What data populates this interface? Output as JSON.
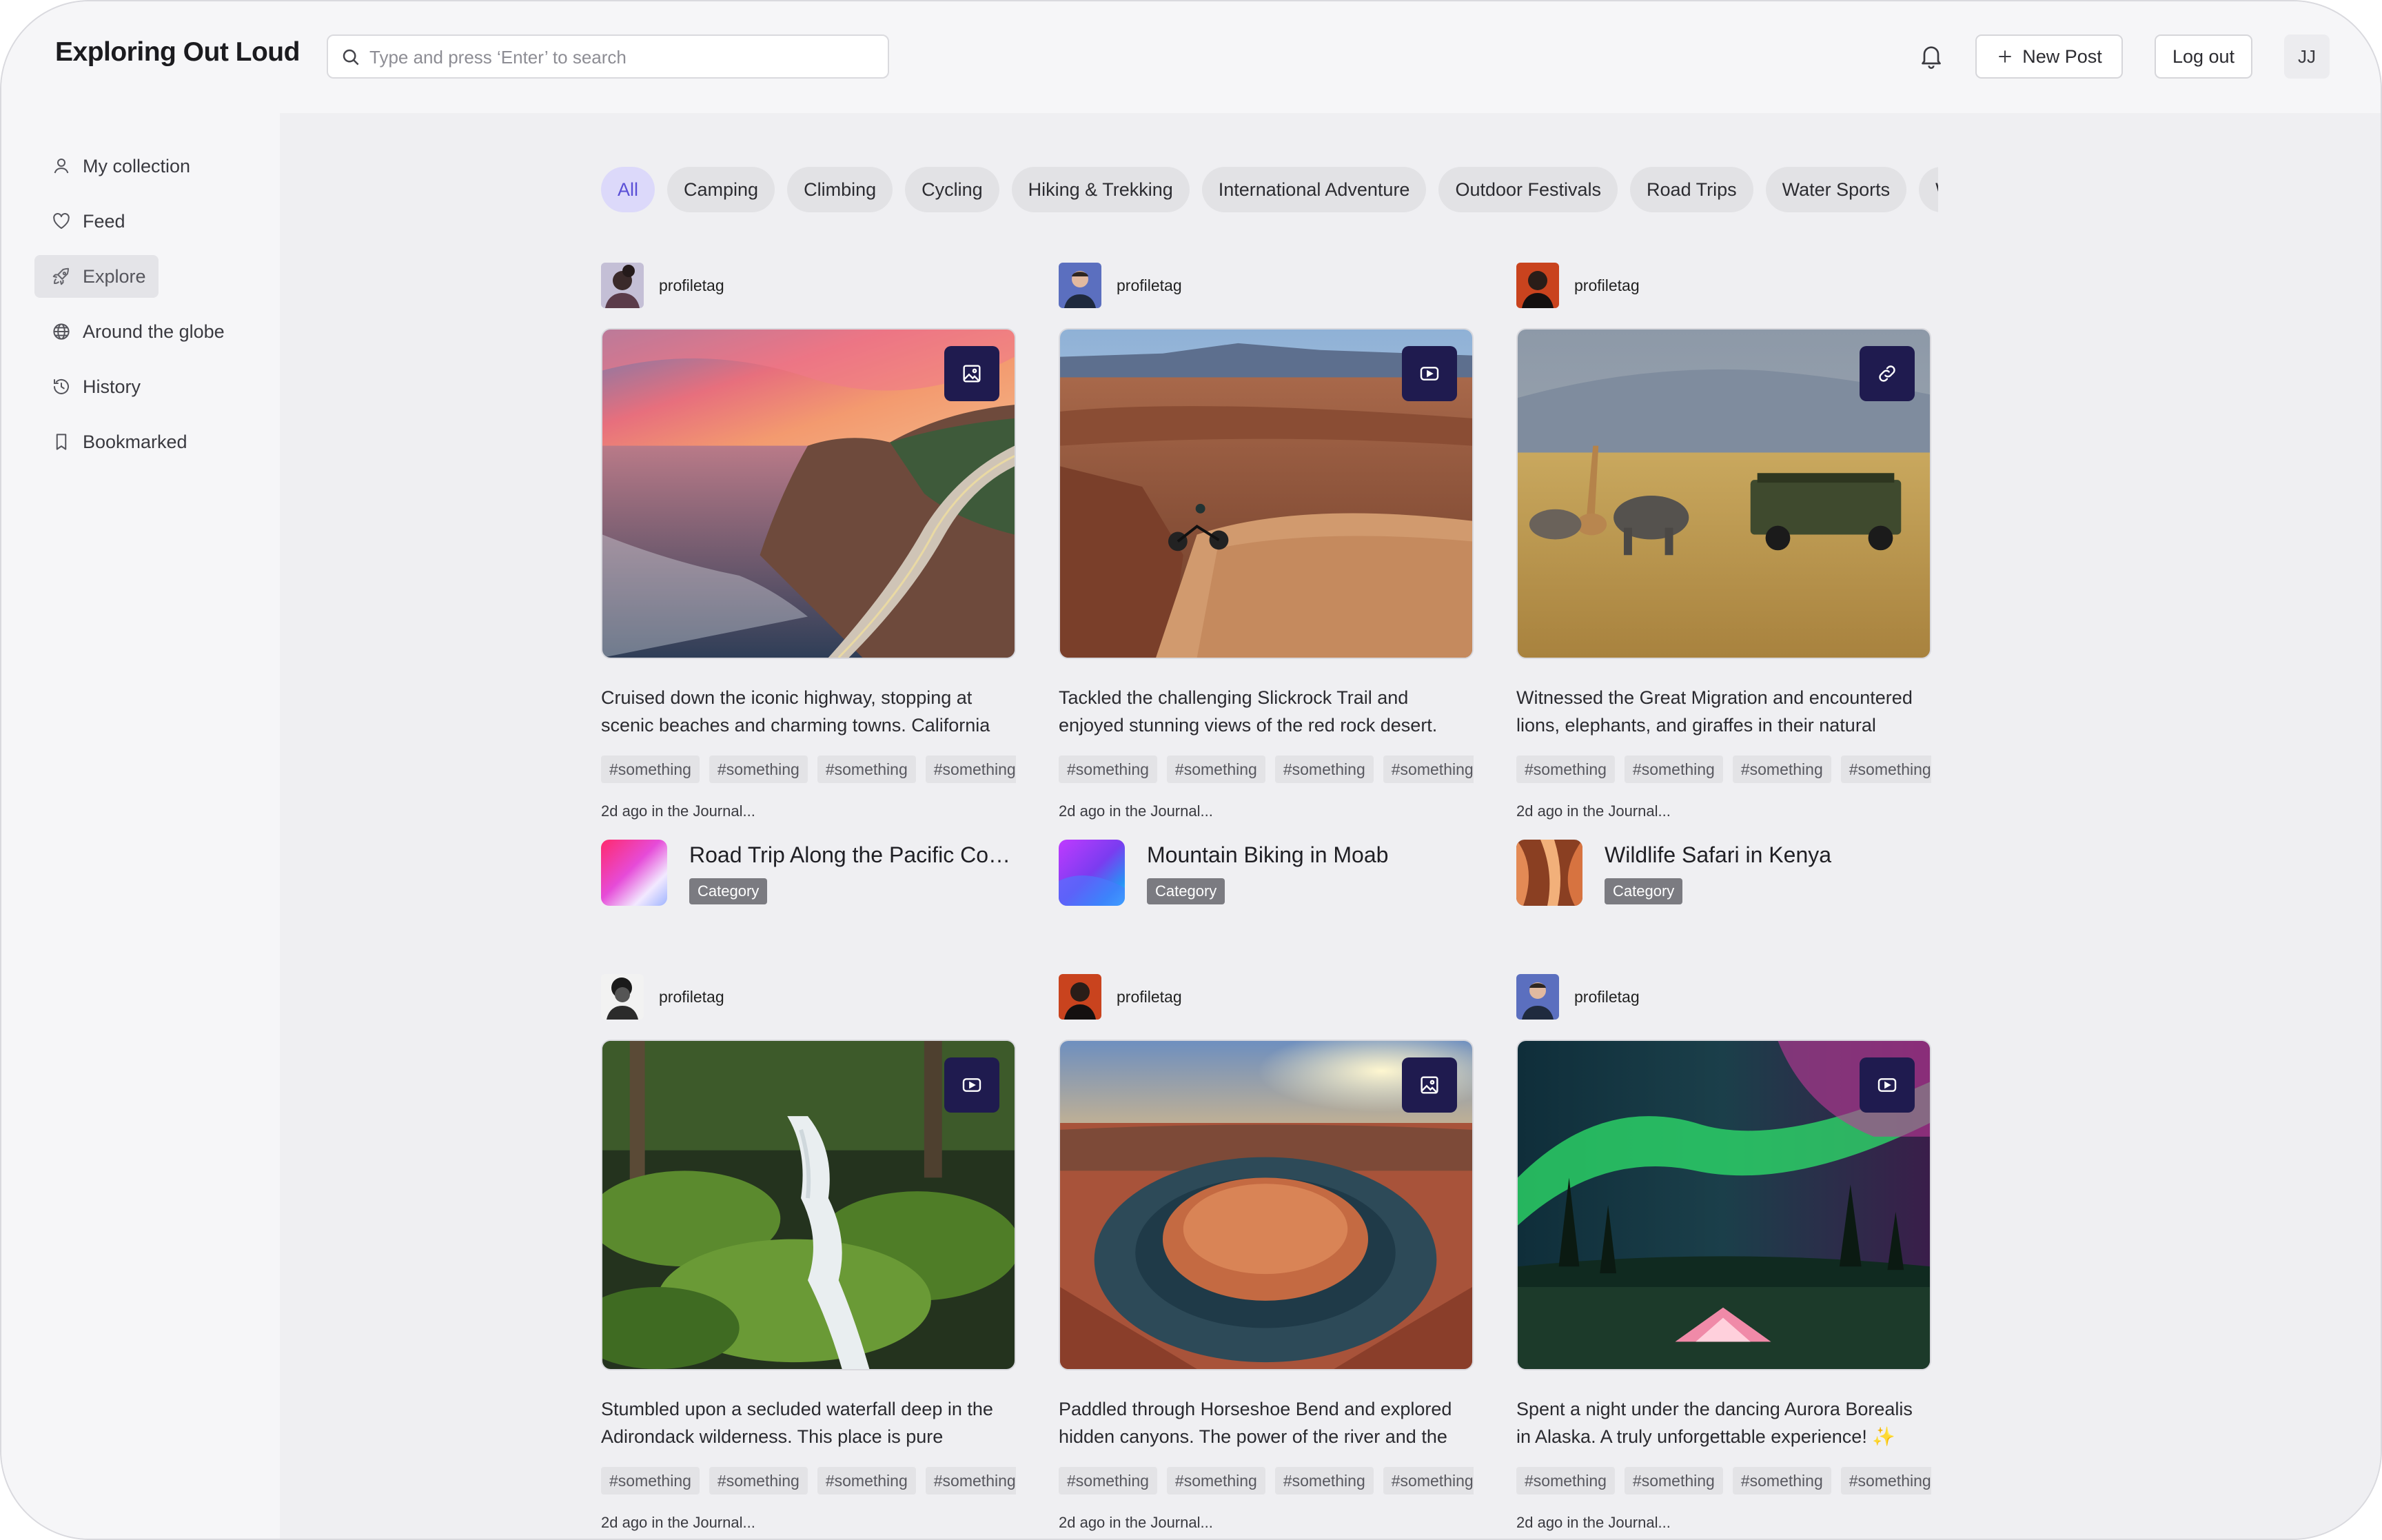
{
  "header": {
    "app_title": "Exploring Out Loud",
    "search_placeholder": "Type and press ‘Enter’ to search",
    "new_post_label": "New Post",
    "logout_label": "Log out",
    "user_initials": "JJ"
  },
  "sidebar": {
    "items": [
      {
        "label": "My collection",
        "icon": "user-icon"
      },
      {
        "label": "Feed",
        "icon": "heart-icon"
      },
      {
        "label": "Explore",
        "icon": "rocket-icon",
        "active": true
      },
      {
        "label": "Around the globe",
        "icon": "globe-icon"
      },
      {
        "label": "History",
        "icon": "history-icon"
      },
      {
        "label": "Bookmarked",
        "icon": "bookmark-icon"
      }
    ]
  },
  "filters": {
    "chips": [
      "All",
      "Camping",
      "Climbing",
      "Cycling",
      "Hiking & Trekking",
      "International Adventure",
      "Outdoor Festivals",
      "Road Trips",
      "Water Sports",
      "Wi"
    ],
    "active": "All"
  },
  "posts": [
    {
      "profile": "profiletag",
      "media_icon": "image-icon",
      "description": "Cruised down the iconic highway, stopping at scenic beaches and charming towns. California dr...",
      "tags": [
        "#something",
        "#something",
        "#something",
        "#something"
      ],
      "meta": "2d ago in the Journal...",
      "journal_title": "Road Trip Along the Pacific Coas...",
      "category": "Category"
    },
    {
      "profile": "profiletag",
      "media_icon": "video-icon",
      "description": "Tackled the challenging Slickrock Trail and enjoyed stunning views of the red rock desert. Moab is a m...",
      "tags": [
        "#something",
        "#something",
        "#something",
        "#something"
      ],
      "meta": "2d ago in the Journal...",
      "journal_title": "Mountain Biking in Moab",
      "category": "Category"
    },
    {
      "profile": "profiletag",
      "media_icon": "link-icon",
      "description": "Witnessed the Great Migration and encountered lions, elephants, and giraffes in their natural habita...",
      "tags": [
        "#something",
        "#something",
        "#something",
        "#something"
      ],
      "meta": "2d ago in the Journal...",
      "journal_title": "Wildlife Safari in Kenya",
      "category": "Category"
    },
    {
      "profile": "profiletag",
      "media_icon": "video-icon",
      "description": "Stumbled upon a secluded waterfall deep in the Adirondack wilderness. This place is pure magic!...",
      "tags": [
        "#something",
        "#something",
        "#something",
        "#something"
      ],
      "meta": "2d ago in the Journal..."
    },
    {
      "profile": "profiletag",
      "media_icon": "image-icon",
      "description": "Paddled through Horseshoe Bend and explored hidden canyons. The power of the river and the be...",
      "tags": [
        "#something",
        "#something",
        "#something",
        "#something"
      ],
      "meta": "2d ago in the Journal..."
    },
    {
      "profile": "profiletag",
      "media_icon": "video-icon",
      "description": "Spent a night under the dancing Aurora Borealis in Alaska. A truly unforgettable experience! ✨",
      "tags": [
        "#something",
        "#something",
        "#something",
        "#something"
      ],
      "meta": "2d ago in the Journal..."
    }
  ]
}
